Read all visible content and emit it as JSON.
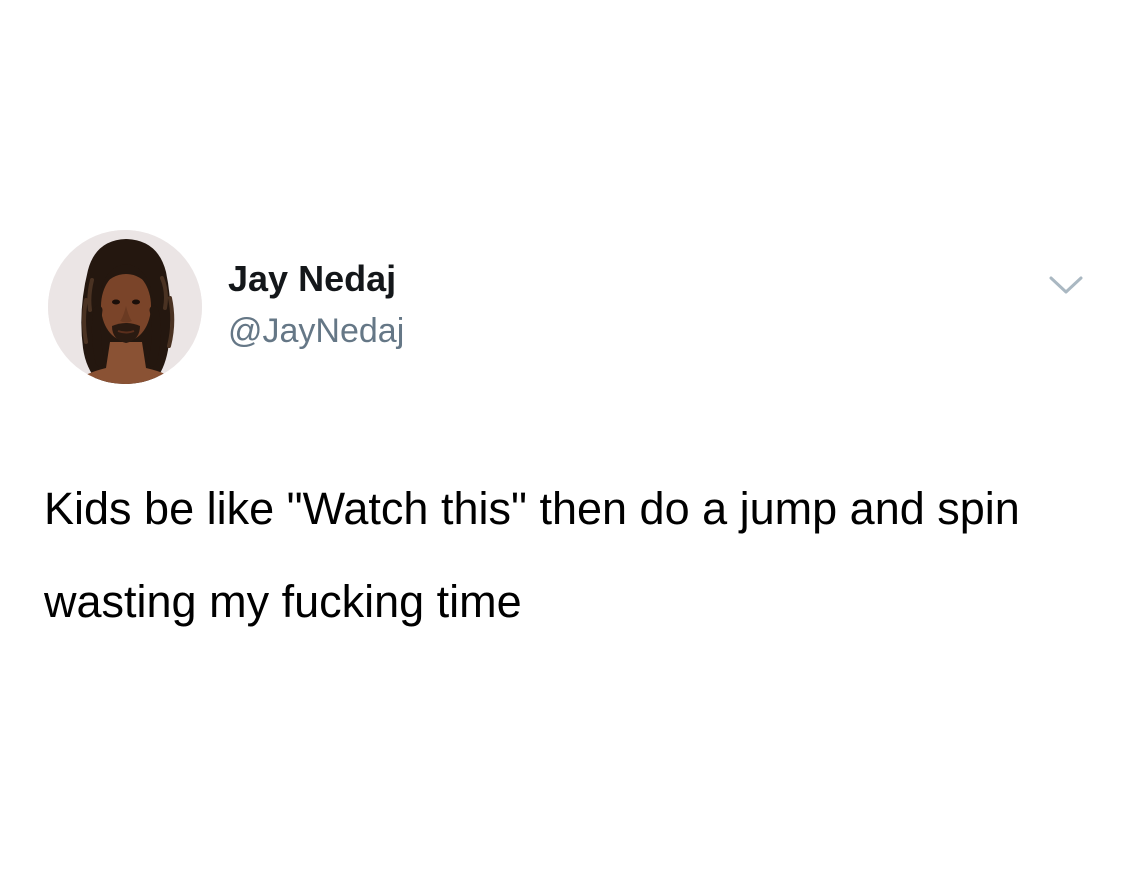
{
  "tweet": {
    "author": {
      "display_name": "Jay Nedaj",
      "handle": "@JayNedaj",
      "avatar_icon": "profile-photo"
    },
    "menu_icon": "chevron-down-icon",
    "text": "Kids be like \"Watch this\" then do a jump and spin wasting my fucking time"
  },
  "colors": {
    "background": "#ffffff",
    "primary_text": "#14171a",
    "secondary_text": "#657786",
    "chevron": "#aab8c2"
  }
}
